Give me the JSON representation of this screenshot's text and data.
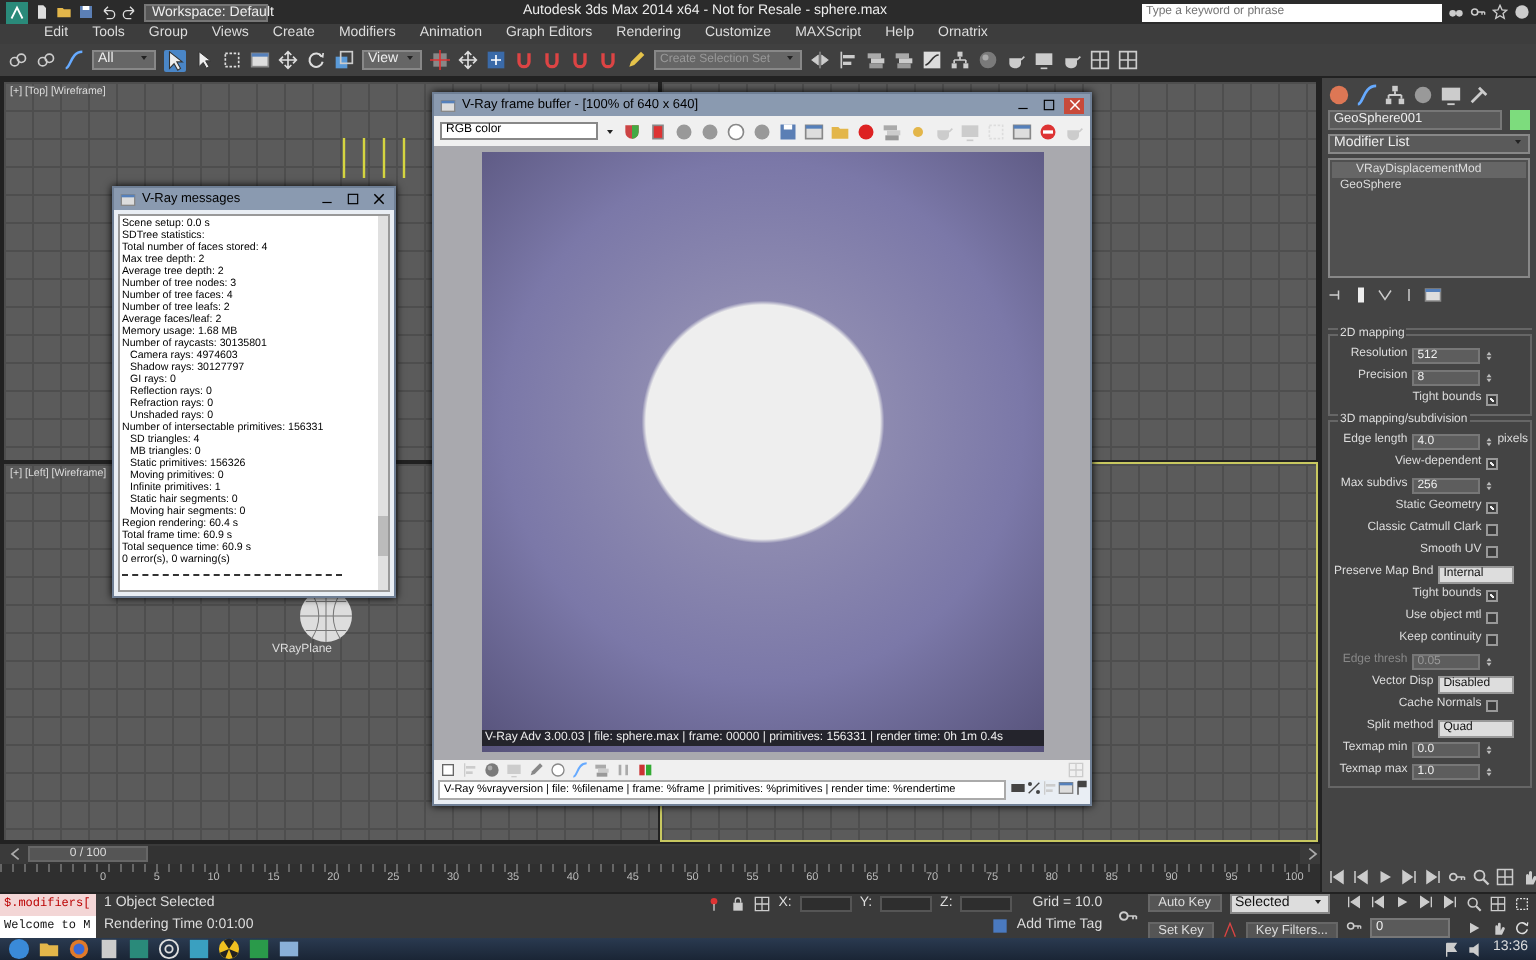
{
  "app": {
    "workspace": "Workspace: Default",
    "title": "Autodesk 3ds Max 2014 x64 - Not for Resale - sphere.max",
    "search_placeholder": "Type a keyword or phrase"
  },
  "menu": [
    "Edit",
    "Tools",
    "Group",
    "Views",
    "Create",
    "Modifiers",
    "Animation",
    "Graph Editors",
    "Rendering",
    "Customize",
    "MAXScript",
    "Help",
    "Ornatrix"
  ],
  "toolbar": {
    "selection_filter": "All",
    "reference_coordinates": "View",
    "named_selection": "Create Selection Set"
  },
  "viewports": [
    {
      "label": "[+] [Top] [Wireframe]"
    },
    {
      "label": "[+] [Left] [Wireframe]",
      "object_label": "VRayPlane"
    }
  ],
  "vray_messages": {
    "title": "V-Ray messages",
    "lines": [
      {
        "text": "Scene setup: 0.0 s"
      },
      {
        "text": "SDTree statistics:"
      },
      {
        "text": "Total number of faces stored: 4"
      },
      {
        "text": "Max tree depth: 2"
      },
      {
        "text": "Average tree depth: 2"
      },
      {
        "text": "Number of tree nodes: 3"
      },
      {
        "text": "Number of tree faces: 4"
      },
      {
        "text": "Number of tree leafs: 2"
      },
      {
        "text": "Average faces/leaf: 2"
      },
      {
        "text": "Memory usage: 1.68 MB"
      },
      {
        "text": "Number of raycasts: 30135801",
        "children": [
          {
            "text": "Camera rays: 4974603"
          },
          {
            "text": "Shadow rays: 30127797"
          },
          {
            "text": "GI rays: 0"
          },
          {
            "text": "Reflection rays: 0"
          },
          {
            "text": "Refraction rays: 0"
          },
          {
            "text": "Unshaded rays: 0"
          }
        ]
      },
      {
        "text": "Number of intersectable primitives: 156331",
        "children": [
          {
            "text": "SD triangles: 4"
          },
          {
            "text": "MB triangles: 0"
          },
          {
            "text": "Static primitives: 156326"
          },
          {
            "text": "Moving primitives: 0"
          },
          {
            "text": "Infinite primitives: 1"
          },
          {
            "text": "Static hair segments: 0"
          },
          {
            "text": "Moving hair segments: 0"
          }
        ]
      },
      {
        "text": "Region rendering: 60.4 s"
      },
      {
        "text": "Total frame time: 60.9 s"
      },
      {
        "text": "Total sequence time: 60.9 s"
      },
      {
        "text": "0 error(s), 0 warning(s)"
      }
    ]
  },
  "frame_buffer": {
    "title": "V-Ray frame buffer - [100% of 640 x 640]",
    "channel": "RGB color",
    "stamp": "V-Ray Adv 3.00.03 | file: sphere.max | frame: 00000 | primitives: 156331 | render time: 0h 1m 0.4s",
    "stamp_template": "V-Ray %vrayversion | file: %filename | frame: %frame | primitives: %primitives | render time: %rendertime"
  },
  "command_panel": {
    "object_name": "GeoSphere001",
    "modifier_list": "Modifier List",
    "stack": [
      {
        "label": "VRayDisplacementMod",
        "selected": true
      },
      {
        "label": "GeoSphere",
        "selected": false
      }
    ],
    "rollouts": [
      {
        "title": "2D mapping",
        "params": [
          {
            "kind": "spinner",
            "label": "Resolution",
            "value": "512",
            "disabled": false
          },
          {
            "kind": "spinner",
            "label": "Precision",
            "value": "8",
            "disabled": false
          },
          {
            "kind": "check",
            "label": "Tight bounds",
            "checked": true,
            "disabled": false
          }
        ]
      },
      {
        "title": "3D mapping/subdivision",
        "params": [
          {
            "kind": "spinner",
            "label": "Edge length",
            "value": "4.0",
            "unit": "pixels",
            "disabled": false
          },
          {
            "kind": "check",
            "label": "View-dependent",
            "checked": true,
            "disabled": false
          },
          {
            "kind": "spinner",
            "label": "Max subdivs",
            "value": "256",
            "disabled": false
          },
          {
            "kind": "check",
            "label": "Static Geometry",
            "checked": true,
            "disabled": false
          },
          {
            "kind": "check",
            "label": "Classic Catmull Clark",
            "checked": false,
            "disabled": false
          },
          {
            "kind": "check",
            "label": "Smooth UV",
            "checked": false,
            "disabled": false
          },
          {
            "kind": "dropdown",
            "label": "Preserve Map Bnd",
            "value": "Internal",
            "disabled": false
          },
          {
            "kind": "check",
            "label": "Tight bounds",
            "checked": true,
            "disabled": false
          },
          {
            "kind": "check",
            "label": "Use object mtl",
            "checked": false,
            "disabled": false
          },
          {
            "kind": "check",
            "label": "Keep continuity",
            "checked": false,
            "disabled": false
          },
          {
            "kind": "spinner",
            "label": "Edge thresh",
            "value": "0.05",
            "disabled": true
          },
          {
            "kind": "dropdown",
            "label": "Vector Disp",
            "value": "Disabled",
            "disabled": false
          },
          {
            "kind": "check",
            "label": "Cache Normals",
            "checked": false,
            "disabled": false
          },
          {
            "kind": "dropdown",
            "label": "Split method",
            "value": "Quad",
            "disabled": false
          },
          {
            "kind": "spinner",
            "label": "Texmap min",
            "value": "0.0",
            "disabled": false
          },
          {
            "kind": "spinner",
            "label": "Texmap max",
            "value": "1.0",
            "disabled": false
          }
        ]
      }
    ]
  },
  "time_slider": {
    "label": "0 / 100"
  },
  "track_bar": {
    "ticks": [
      "0",
      "5",
      "10",
      "15",
      "20",
      "25",
      "30",
      "35",
      "40",
      "45",
      "50",
      "55",
      "60",
      "65",
      "70",
      "75",
      "80",
      "85",
      "90",
      "95",
      "100"
    ]
  },
  "status_bar": {
    "maxscript": [
      "$.modifiers[",
      "Welcome to M"
    ],
    "selection": "1 Object Selected",
    "render_time": "Rendering Time  0:01:00",
    "coordinates": [
      {
        "label": "X:"
      },
      {
        "label": "Y:"
      },
      {
        "label": "Z:"
      }
    ],
    "grid": "Grid = 10.0",
    "time_tag": "Add Time Tag",
    "auto_key": "Auto Key",
    "key_mode": "Selected",
    "set_key": "Set Key",
    "key_filters": "Key Filters...",
    "frame": "0"
  },
  "taskbar": {
    "clock": "13:36"
  }
}
